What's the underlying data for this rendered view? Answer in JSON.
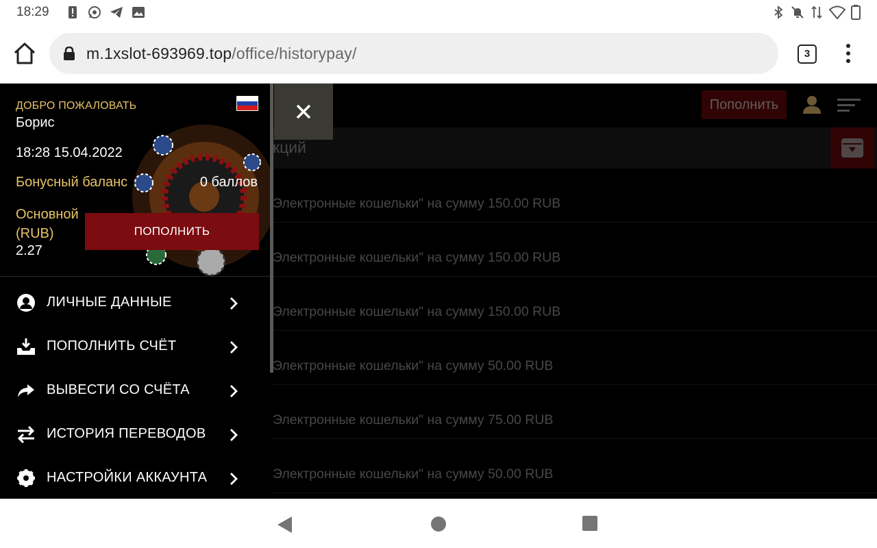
{
  "status_bar": {
    "time": "18:29",
    "left_icons": [
      "alert-icon",
      "whatsapp-icon",
      "telegram-icon",
      "image-icon"
    ],
    "right_icons": [
      "bluetooth-icon",
      "notifications-off-icon",
      "data-arrows-icon",
      "wifi-icon",
      "battery-icon"
    ]
  },
  "browser": {
    "url_domain": "m.1xslot-693969.top",
    "url_path": "/office/historypay/",
    "tab_count": "3"
  },
  "page": {
    "top_deposit_label": "Пополнить",
    "subheader_title": "кций",
    "history_rows": [
      "Электронные кошельки\" на сумму 150.00 RUB",
      "Электронные кошельки\" на сумму 150.00 RUB",
      "Электронные кошельки\" на сумму 150.00 RUB",
      "Электронные кошельки\" на сумму 50.00 RUB",
      "Электронные кошельки\" на сумму 75.00 RUB",
      "Электронные кошельки\" на сумму 50.00 RUB"
    ]
  },
  "drawer": {
    "welcome": "ДОБРО ПОЖАЛОВАТЬ",
    "user_name": "Борис",
    "datetime": "18:28 15.04.2022",
    "bonus_label": "Бонусный баланс",
    "bonus_value": "0 баллов",
    "main_label": "Основной (RUB)",
    "main_value": "2.27",
    "deposit_button": "ПОПОЛНИТЬ",
    "menu": [
      {
        "label": "ЛИЧНЫЕ ДАННЫЕ",
        "icon": "user-circle-icon"
      },
      {
        "label": "ПОПОЛНИТЬ СЧЁТ",
        "icon": "download-tray-icon"
      },
      {
        "label": "ВЫВЕСТИ СО СЧЁТА",
        "icon": "share-arrow-icon"
      },
      {
        "label": "ИСТОРИЯ ПЕРЕВОДОВ",
        "icon": "transfer-arrows-icon"
      },
      {
        "label": "НАСТРОЙКИ АККАУНТА",
        "icon": "gear-icon"
      }
    ]
  },
  "colors": {
    "accent_gold": "#e8c466",
    "deposit_red": "#7b0c10",
    "dark_red": "#4a0707"
  }
}
